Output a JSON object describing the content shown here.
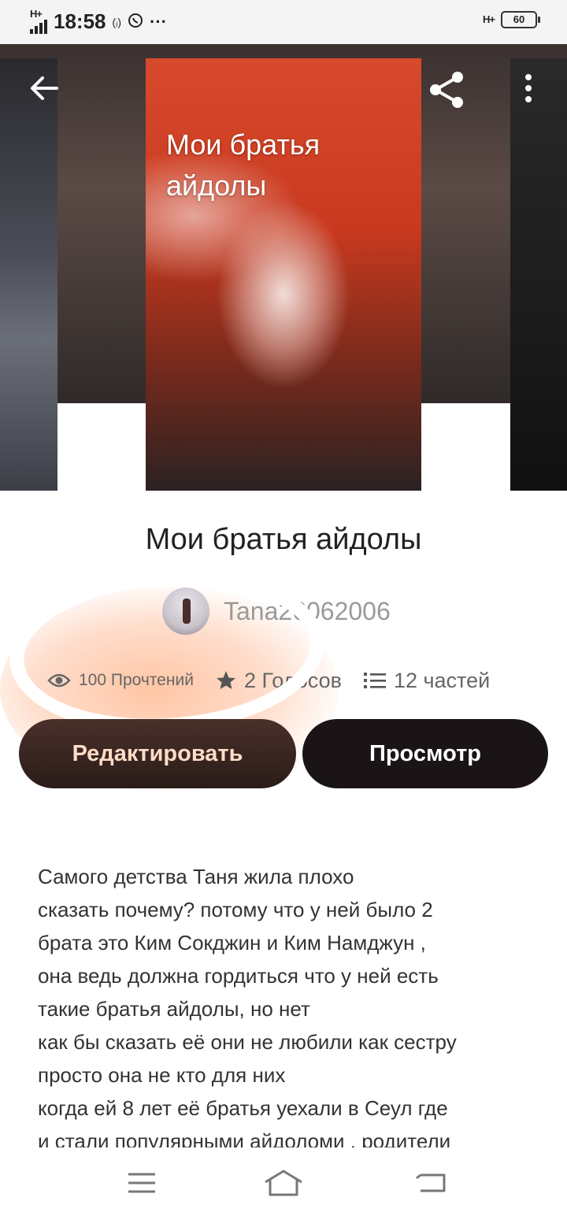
{
  "status_bar": {
    "network": "H+",
    "time": "18:58",
    "extra_icons": "(ᵢ)",
    "dots": "···",
    "right_network": "H+",
    "battery": "60"
  },
  "cover": {
    "title": "Мои братья айдолы"
  },
  "book": {
    "title": "Мои братья айдолы",
    "author": "Tana26062006",
    "reads": "100 Прочтений",
    "votes": "2 Голосов",
    "parts": "12 частей"
  },
  "actions": {
    "edit_label": "Редактировать",
    "view_label": "Просмотр"
  },
  "description": [
    "Самого детства Таня жила плохо",
    "сказать почему? потому что у ней было 2",
    "брата это Ким Сокджин и Ким Намджун  ,",
    "она ведь должна гордиться что у ней есть",
    "такие братья айдолы, но нет",
    "как бы сказать её они не любили как сестру",
    "просто она не кто для них",
    "когда ей 8 лет её братья уехали в Сеул где",
    "и стали популярными айдоломи , родители"
  ],
  "icons": {
    "back": "arrow-left-icon",
    "share": "share-icon",
    "more": "more-vertical-icon",
    "reads": "eye-icon",
    "votes": "star-icon",
    "parts": "list-icon"
  }
}
